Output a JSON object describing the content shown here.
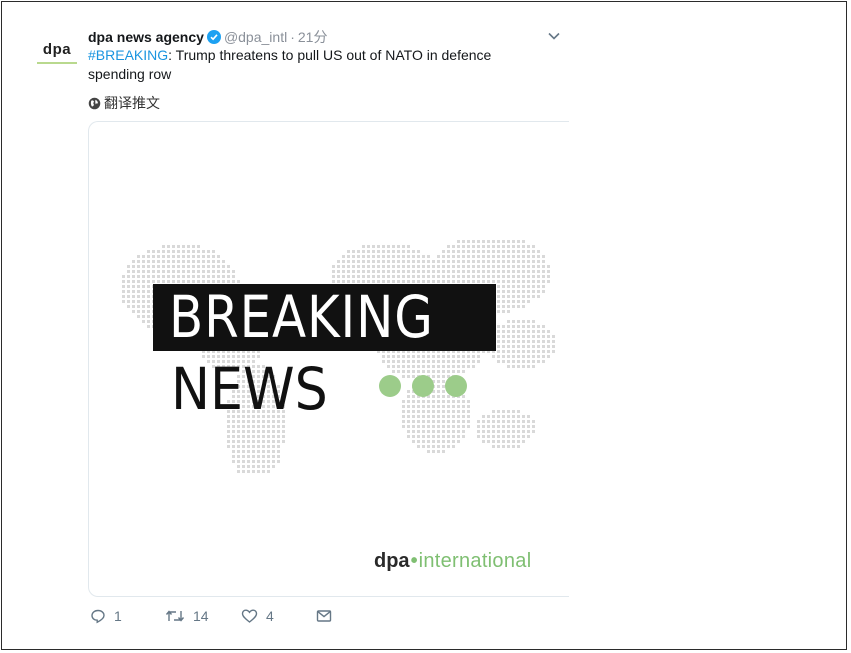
{
  "account": {
    "avatar_text": "dpa",
    "name": "dpa news agency",
    "handle": "@dpa_intl",
    "separator": "·",
    "time": "21分"
  },
  "tweet": {
    "hashtag": "#BREAKING",
    "text": ": Trump threatens to pull US out of NATO in defence spending row",
    "translate_label": "翻译推文"
  },
  "card": {
    "line1": "BREAKING",
    "line2": "NEWS",
    "brand_main": "dpa",
    "brand_sep": "•",
    "brand_sub": "international"
  },
  "actions": {
    "reply_count": "1",
    "retweet_count": "14",
    "like_count": "4"
  },
  "colors": {
    "link": "#1b95e0",
    "verified": "#1da1f2",
    "accent_green": "#9ccc8a"
  },
  "icons": [
    "verified-icon",
    "chevron-down-icon",
    "globe-icon",
    "reply-icon",
    "retweet-icon",
    "like-icon",
    "direct-message-icon"
  ]
}
